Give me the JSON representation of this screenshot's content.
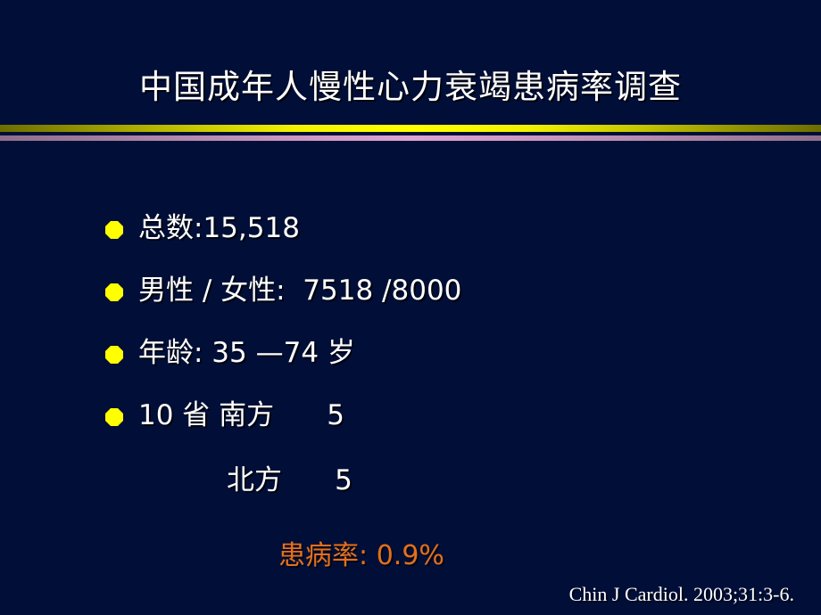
{
  "slide": {
    "background_color": "#010f38",
    "title": "中国成年人慢性心力衰竭患病率调查",
    "divider": {
      "top_rule_color": "#ffff00",
      "top_rule_edge_color": "#6d6d00",
      "bottom_rule_color": "#dca4d1",
      "bottom_rule_edge_color": "#8e6f8b"
    },
    "bullets": [
      {
        "marker": "octagon-bullet",
        "text": "总数:15,518"
      },
      {
        "marker": "octagon-bullet",
        "text": "男性 / 女性:  7518 /8000"
      },
      {
        "marker": "octagon-bullet",
        "text": "年龄: 35 —74 岁"
      },
      {
        "marker": "octagon-bullet",
        "text": "10 省 南方      5"
      }
    ],
    "sub_line": "北方      5",
    "highlight": {
      "text": "患病率: 0.9%",
      "color": "#e4701b"
    },
    "citation": "Chin J Cardiol. 2003;31:3-6."
  }
}
